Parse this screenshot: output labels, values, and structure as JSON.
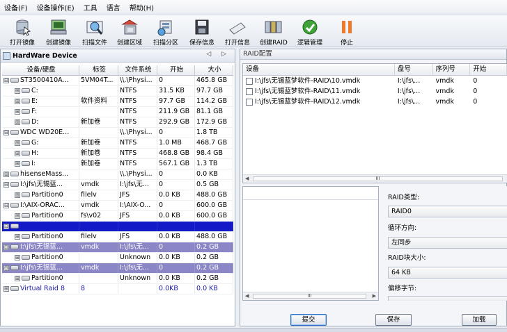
{
  "menu": [
    "设备(F)",
    "设备操作(E)",
    "工具",
    "语言",
    "帮助(H)"
  ],
  "toolbar": [
    {
      "label": "打开镜像",
      "icon": "open-image-icon"
    },
    {
      "label": "创建镜像",
      "icon": "create-image-icon"
    },
    {
      "label": "扫描文件",
      "icon": "scan-file-icon"
    },
    {
      "label": "创建区域",
      "icon": "create-region-icon"
    },
    {
      "label": "扫描分区",
      "icon": "scan-partition-icon"
    },
    {
      "label": "保存信息",
      "icon": "save-info-icon"
    },
    {
      "label": "打开信息",
      "icon": "open-info-icon"
    },
    {
      "label": "创建RAID",
      "icon": "create-raid-icon"
    },
    {
      "label": "逻辑管理",
      "icon": "logic-manage-icon"
    },
    {
      "label": "停止",
      "icon": "stop-icon"
    }
  ],
  "left": {
    "title": "HardWare Device",
    "nav": "◁ ▷",
    "columns": [
      "设备/硬盘",
      "标签",
      "文件系统",
      "开始",
      "大小"
    ],
    "rows": [
      {
        "level": 0,
        "expander": "⊟",
        "name": "ST3500410A...",
        "label": "5VM04T...",
        "fs": "\\\\.\\Physi...",
        "start": "0",
        "size": "465.8 GB",
        "style": ""
      },
      {
        "level": 1,
        "expander": "⊞",
        "name": "C:",
        "label": "",
        "fs": "NTFS",
        "start": "31.5 KB",
        "size": "97.7 GB",
        "style": ""
      },
      {
        "level": 1,
        "expander": "⊞",
        "name": "E:",
        "label": "软件资料",
        "fs": "NTFS",
        "start": "97.7 GB",
        "size": "114.2 GB",
        "style": ""
      },
      {
        "level": 1,
        "expander": "⊞",
        "name": "F:",
        "label": "",
        "fs": "NTFS",
        "start": "211.9 GB",
        "size": "81.1 GB",
        "style": ""
      },
      {
        "level": 1,
        "expander": "⊞",
        "name": "D:",
        "label": "新加卷",
        "fs": "NTFS",
        "start": "292.9 GB",
        "size": "172.9 GB",
        "style": ""
      },
      {
        "level": 0,
        "expander": "⊟",
        "name": "WDC WD20E...",
        "label": "",
        "fs": "\\\\.\\Physi...",
        "start": "0",
        "size": "1.8 TB",
        "style": ""
      },
      {
        "level": 1,
        "expander": "⊞",
        "name": "G:",
        "label": "新加卷",
        "fs": "NTFS",
        "start": "1.0 MB",
        "size": "468.7 GB",
        "style": ""
      },
      {
        "level": 1,
        "expander": "⊞",
        "name": "H:",
        "label": "新加卷",
        "fs": "NTFS",
        "start": "468.8 GB",
        "size": "98.4 GB",
        "style": ""
      },
      {
        "level": 1,
        "expander": "⊞",
        "name": "I:",
        "label": "新加卷",
        "fs": "NTFS",
        "start": "567.1 GB",
        "size": "1.3 TB",
        "style": ""
      },
      {
        "level": 0,
        "expander": "⊞",
        "name": "hisenseMass...",
        "label": "",
        "fs": "\\\\.\\Physi...",
        "start": "0",
        "size": "0.0 KB",
        "style": ""
      },
      {
        "level": 0,
        "expander": "⊟",
        "name": "I:\\jfs\\无锡蓝...",
        "label": "vmdk",
        "fs": "I:\\jfs\\无...",
        "start": "0",
        "size": "0.5 GB",
        "style": ""
      },
      {
        "level": 1,
        "expander": "⊞",
        "name": "Partition0",
        "label": "filelv",
        "fs": "JFS",
        "start": "0.0 KB",
        "size": "488.0 GB",
        "style": ""
      },
      {
        "level": 0,
        "expander": "⊟",
        "name": "I:\\AIX-ORAC...",
        "label": "vmdk",
        "fs": "I:\\AIX-O...",
        "start": "0",
        "size": "600.0 GB",
        "style": ""
      },
      {
        "level": 1,
        "expander": "⊞",
        "name": "Partition0",
        "label": "fs\\v02",
        "fs": "JFS",
        "start": "0.0 KB",
        "size": "600.0 GB",
        "style": ""
      },
      {
        "level": 0,
        "expander": "⊟",
        "name": "",
        "label": "",
        "fs": "",
        "start": "",
        "size": "",
        "style": "dark"
      },
      {
        "level": 1,
        "expander": "⊞",
        "name": "Partition0",
        "label": "filelv",
        "fs": "JFS",
        "start": "0.0 KB",
        "size": "488.0 GB",
        "style": ""
      },
      {
        "level": 0,
        "expander": "⊟",
        "name": "I:\\jfs\\无锡蓝...",
        "label": "vmdk",
        "fs": "I:\\jfs\\无...",
        "start": "0",
        "size": "0.2 GB",
        "style": "light"
      },
      {
        "level": 1,
        "expander": "⊞",
        "name": "Partition0",
        "label": "",
        "fs": "Unknown",
        "start": "0.0 KB",
        "size": "0.2 GB",
        "style": ""
      },
      {
        "level": 0,
        "expander": "⊟",
        "name": "I:\\jfs\\无锡蓝...",
        "label": "vmdk",
        "fs": "I:\\jfs\\无...",
        "start": "0",
        "size": "0.2 GB",
        "style": "light"
      },
      {
        "level": 1,
        "expander": "⊞",
        "name": "Partition0",
        "label": "",
        "fs": "Unknown",
        "start": "0.0 KB",
        "size": "0.2 GB",
        "style": ""
      },
      {
        "level": 0,
        "expander": "⊞",
        "name": "Virtual Raid 8",
        "label": "8",
        "fs": "",
        "start": "0.0KB",
        "size": "0.0 KB",
        "style": "blue"
      }
    ]
  },
  "right": {
    "title": "RAID配置",
    "columns": [
      "设备",
      "盘号",
      "序列号",
      "开始"
    ],
    "rows": [
      {
        "device": "I:\\jfs\\无锡蓝梦软件-RAID\\10.vmdk",
        "disk": "I:\\jfs\\...",
        "serial": "vmdk",
        "start": "0"
      },
      {
        "device": "I:\\jfs\\无锡蓝梦软件-RAID\\11.vmdk",
        "disk": "I:\\jfs\\...",
        "serial": "vmdk",
        "start": "0"
      },
      {
        "device": "I:\\jfs\\无锡蓝梦软件-RAID\\12.vmdk",
        "disk": "I:\\jfs\\...",
        "serial": "vmdk",
        "start": "0"
      }
    ],
    "scroll_mark": "III",
    "raid_type_label": "RAID类型:",
    "raid_type_value": "RAID0",
    "direction_label": "循环方向:",
    "direction_value": "左同步",
    "block_label": "RAID块大小:",
    "block_value": "64 KB",
    "offset_label": "偏移字节:",
    "submit": "提交",
    "save": "保存",
    "load": "加载"
  }
}
